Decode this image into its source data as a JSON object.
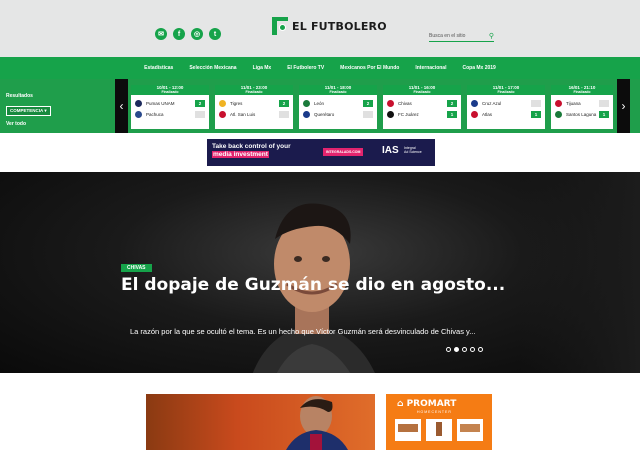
{
  "header": {
    "logo_text": "EL FUTBOLERO",
    "socials": [
      "mail-icon",
      "facebook-icon",
      "instagram-icon",
      "twitter-icon"
    ],
    "search_placeholder": "Busca en el sitio"
  },
  "nav": {
    "items": [
      "Estadísticas",
      "Selección Mexicana",
      "Liga Mx",
      "El Futbolero TV",
      "Mexicanos Por El Mundo",
      "Internacional",
      "Copa Mx 2019"
    ]
  },
  "scores": {
    "label": "Resultados",
    "competition_button": "COMPETENCIA",
    "view_all": "Ver todo",
    "matches": [
      {
        "date": "10/01 - 12:00",
        "status": "Finalizado",
        "home": "Pumas UNAM",
        "home_score": "2",
        "away": "Pachuca",
        "away_score": "",
        "home_color": "#1d2a5c",
        "away_color": "#2a4a8c"
      },
      {
        "date": "11/01 - 23:00",
        "status": "Finalizado",
        "home": "Tigres",
        "home_score": "2",
        "away": "Atl. San Luis",
        "away_score": "",
        "home_color": "#f0b323",
        "away_color": "#c8102e"
      },
      {
        "date": "11/01 - 18:00",
        "status": "Finalizado",
        "home": "León",
        "home_score": "2",
        "away": "Querétaro",
        "away_score": "",
        "home_color": "#1a7a3a",
        "away_color": "#1a3a8a"
      },
      {
        "date": "11/01 - 16:00",
        "status": "Finalizado",
        "home": "Chivas",
        "home_score": "2",
        "away": "FC Juárez",
        "away_score": "1",
        "home_color": "#c8102e",
        "away_color": "#111111"
      },
      {
        "date": "11/01 - 17:00",
        "status": "Finalizado",
        "home": "Cruz Azul",
        "home_score": "",
        "away": "Atlas",
        "away_score": "1",
        "home_color": "#1a3a8a",
        "away_color": "#c8102e"
      },
      {
        "date": "16/01 - 21:10",
        "status": "Finalizado",
        "home": "Tijuana",
        "home_score": "",
        "away": "Santos Laguna",
        "away_score": "1",
        "home_color": "#c8102e",
        "away_color": "#1a7a3a"
      }
    ]
  },
  "ad": {
    "line1": "Take back control of your",
    "line2": "media investment",
    "cta": "INTEGRALADS.COM",
    "brand": "IAS",
    "brand_sub1": "Integral",
    "brand_sub2": "Ad Science"
  },
  "hero": {
    "tag": "CHIVAS",
    "headline": "El dopaje de Guzmán se dio en agosto...",
    "dek": "La razón por la que se ocultó el tema. Es un hecho que Víctor Guzmán será desvinculado de Chivas y...",
    "slide_count": 5,
    "active_slide": 2
  },
  "promo": {
    "brand": "PROMART",
    "sub": "HOMECENTER"
  }
}
